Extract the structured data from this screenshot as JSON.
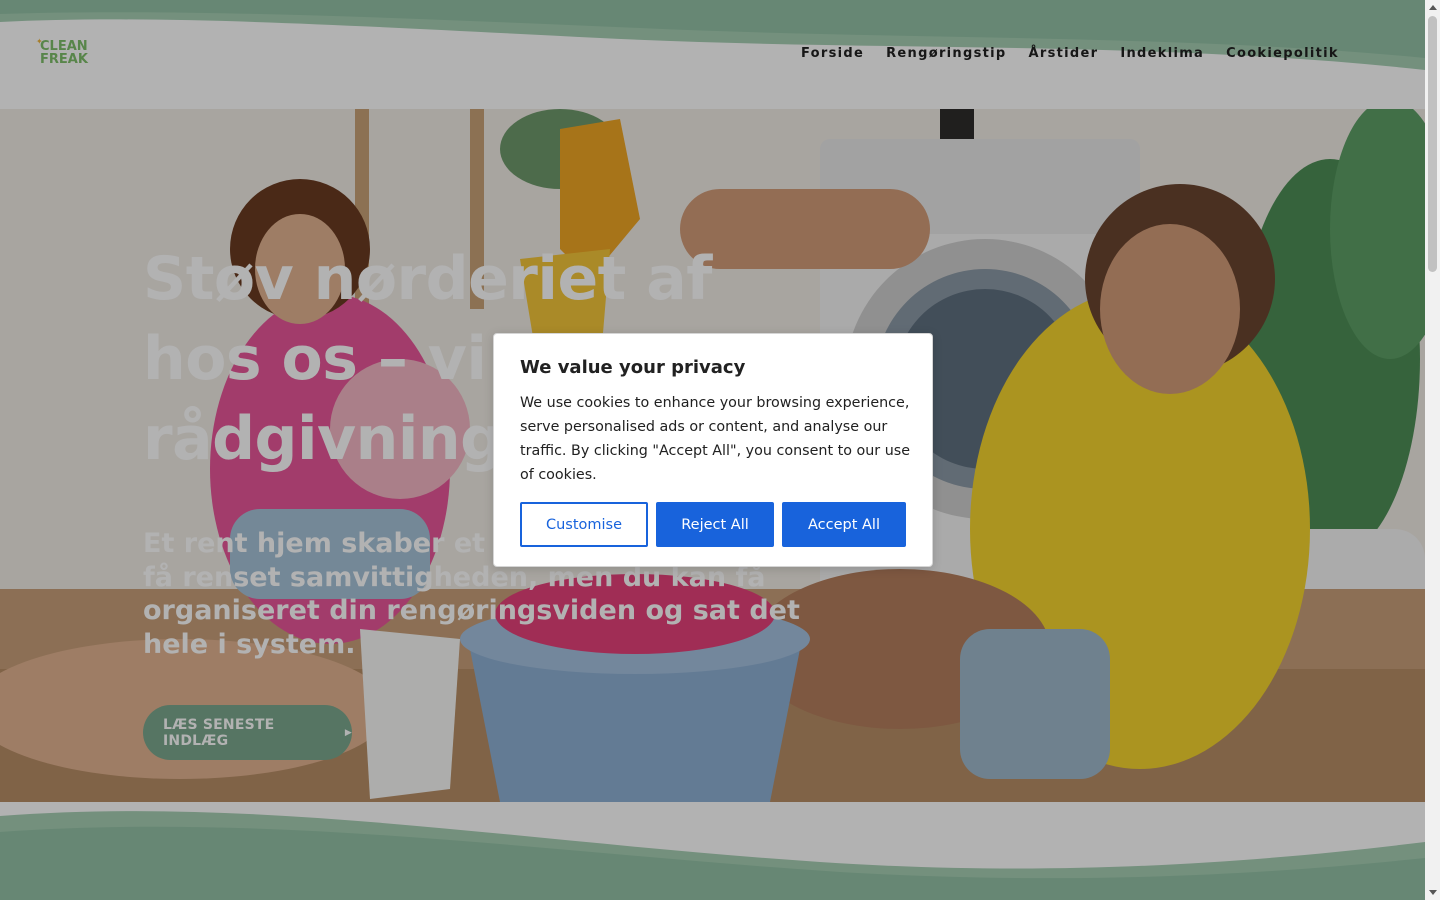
{
  "header": {
    "logo_line1": "CLEAN",
    "logo_line2": "FREAK",
    "nav": [
      "Forside",
      "Rengøringstip",
      "Årstider",
      "Indeklima",
      "Cookiepolitik"
    ]
  },
  "hero": {
    "title": "Støv nørderiet af hos os – vi har alle rådgivning og tips",
    "subtitle": "Et rent hjem skaber et rent sind. Du kan ikke få renset samvittigheden, men du kan få organiseret din rengøringsviden og sat det hele i system.",
    "button_label": "LÆS SENESTE INDLÆG"
  },
  "cookie_banner": {
    "title": "We value your privacy",
    "text": "We use cookies to enhance your browsing experience, serve personalised ads or content, and analyse our traffic. By clicking \"Accept All\", you consent to our use of cookies.",
    "customise_label": "Customise",
    "reject_label": "Reject All",
    "accept_label": "Accept All"
  },
  "colors": {
    "brand_green": "#7ba88e",
    "logo_green": "#7fbf6a",
    "cookie_blue": "#1863dc"
  }
}
